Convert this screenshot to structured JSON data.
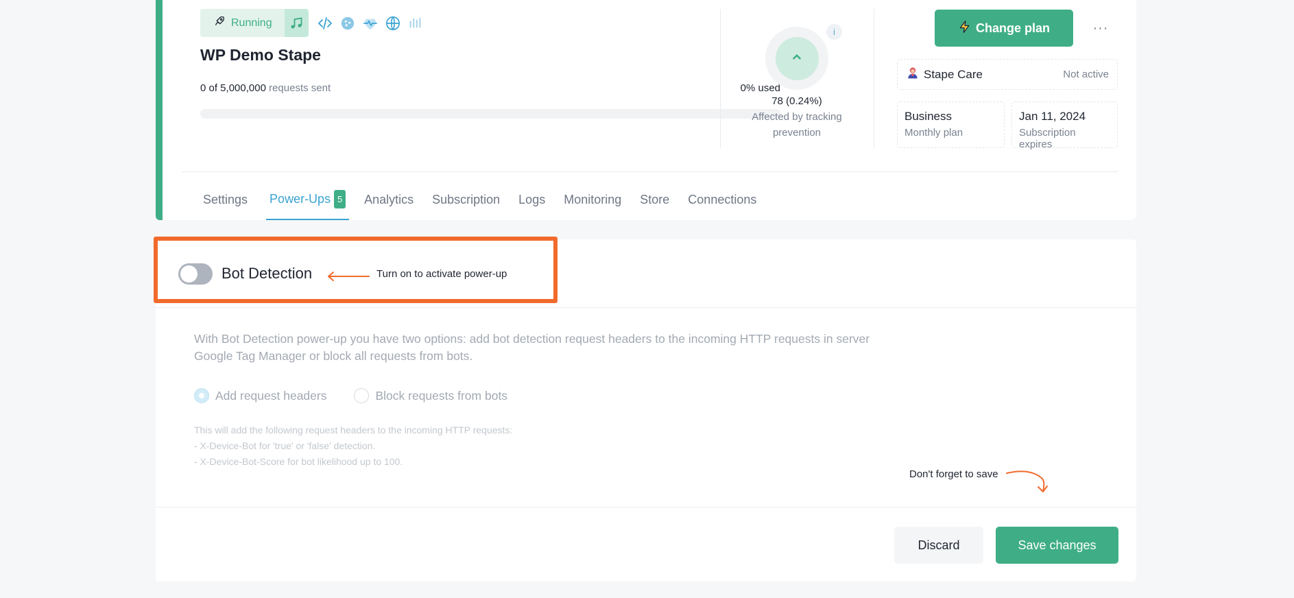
{
  "container": {
    "status": "Running",
    "name": "WP Demo Stape",
    "requests_sent": "0 of 5,000,000",
    "requests_label": "requests sent",
    "used": "0% used",
    "used_fraction": 0
  },
  "tracking": {
    "count": "78 (0.24%)",
    "label": "Affected by tracking prevention",
    "info": "i"
  },
  "plan": {
    "change_plan_label": "Change plan",
    "more": "···",
    "care_label": "Stape Care",
    "care_status": "Not active",
    "plan_name": "Business",
    "plan_type": "Monthly plan",
    "expires_date": "Jan 11, 2024",
    "expires_label": "Subscription expires"
  },
  "tabs": [
    {
      "label": "Settings"
    },
    {
      "label": "Power-Ups",
      "badge": "5",
      "active": true
    },
    {
      "label": "Analytics"
    },
    {
      "label": "Subscription"
    },
    {
      "label": "Logs"
    },
    {
      "label": "Monitoring"
    },
    {
      "label": "Store"
    },
    {
      "label": "Connections"
    }
  ],
  "powerup": {
    "title": "Bot Detection",
    "enabled": false,
    "hint": "Turn on to activate power-up",
    "description": "With Bot Detection power-up you have two options: add bot detection request headers to the incoming HTTP requests in server Google Tag Manager or block all requests from bots.",
    "options": [
      {
        "label": "Add request headers",
        "selected": true
      },
      {
        "label": "Block requests from bots",
        "selected": false
      }
    ],
    "note_lines": [
      "This will add the following request headers to the incoming HTTP requests:",
      "- X-Device-Bot for 'true' or 'false' detection.",
      "- X-Device-Bot-Score for bot likelihood up to 100."
    ]
  },
  "footer": {
    "save_hint": "Don't forget to save",
    "discard_label": "Discard",
    "save_label": "Save changes"
  },
  "colors": {
    "accent": "#3fae86",
    "link": "#3aa3d3",
    "highlight": "#f26a2b"
  },
  "icons": [
    "rocket-icon",
    "music-icon",
    "code-icon",
    "cookie-icon",
    "pulse-icon",
    "globe-icon",
    "bars-icon",
    "chevron-up-icon",
    "lightning-icon",
    "user-care-icon"
  ]
}
